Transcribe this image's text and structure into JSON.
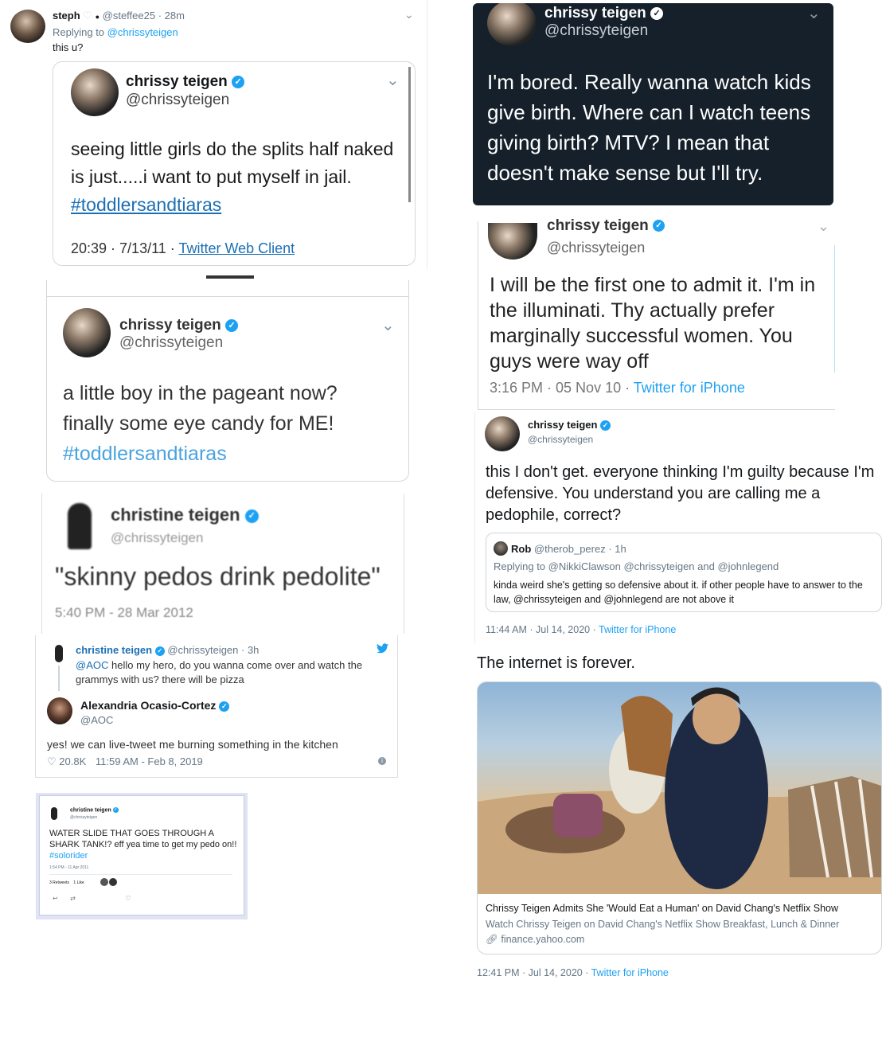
{
  "top_tweet": {
    "name": "steph",
    "handle": "@steffee25",
    "time": "· 28m",
    "replying_prefix": "Replying to",
    "replying_handle": "@chrissyteigen",
    "text": "this u?"
  },
  "s1": {
    "name": "chrissy teigen",
    "handle": "@chrissyteigen",
    "text_main": "seeing little girls do the splits half naked is just.....i want to put myself in jail.",
    "hashtag": "#toddlersandtiaras",
    "meta_time": "20:39 · 7/13/11 ·",
    "meta_source": "Twitter Web Client"
  },
  "s2": {
    "name": "chrissy teigen",
    "handle": "@chrissyteigen",
    "line1": "a little boy in the pageant now?",
    "line2": "finally some eye candy for ME!",
    "hashtag": "#toddlersandtiaras"
  },
  "s3": {
    "name": "christine teigen",
    "handle": "@chrissyteigen",
    "text": "\"skinny pedos drink pedolite\"",
    "meta": "5:40 PM - 28 Mar 2012"
  },
  "s4": {
    "name": "christine teigen",
    "handle": "@chrissyteigen · 3h",
    "mention": "@AOC",
    "text1": "hello my hero, do you wanna come over and watch the",
    "text2": "grammys with us? there will be pizza",
    "reply_name": "Alexandria Ocasio-Cortez",
    "reply_handle": "@AOC",
    "reply_text": "yes! we can live-tweet me burning something in the kitchen",
    "likes": "20.8K",
    "meta": "11:59 AM - Feb 8, 2019"
  },
  "s5": {
    "name": "christine teigen",
    "handle": "@chrissyteigen",
    "text": "WATER SLIDE THAT GOES THROUGH A SHARK TANK!? eff yea time to get my pedo on!!",
    "hashtag": "#solorider",
    "meta": "1:54 PM - 11 Apr 2011",
    "retweets": "3 Retweets",
    "likes": "1 Like"
  },
  "s6": {
    "name": "chrissy teigen",
    "handle": "@chrissyteigen",
    "text": "I'm bored. Really wanna watch kids give birth. Where can I watch teens giving birth? MTV? I mean that doesn't make sense but I'll try."
  },
  "s7": {
    "name": "chrissy teigen",
    "handle": "@chrissyteigen",
    "text": "I will be the first one to admit it. I'm in the illuminati. Thy actually prefer marginally successful women. You guys were way off",
    "meta_time": "3:16 PM · 05 Nov 10 ·",
    "meta_source": "Twitter for iPhone"
  },
  "s8": {
    "name": "chrissy teigen",
    "handle": "@chrissyteigen",
    "text": "this I don't get. everyone thinking I'm guilty because I'm defensive. You understand you are calling me a pedophile, correct?",
    "quote_name": "Rob",
    "quote_handle": "@therob_perez · 1h",
    "quote_replying": "Replying to @NikkiClawson @chrissyteigen and @johnlegend",
    "quote_text": "kinda weird she's getting so defensive about it. if other people have to answer to the law, @chrissyteigen and @johnlegend are not above it",
    "meta_time": "11:44 AM · Jul 14, 2020 ·",
    "meta_source": "Twitter for iPhone"
  },
  "bottom_tweet": {
    "text": "The internet is forever.",
    "card_title": "Chrissy Teigen Admits She 'Would Eat a Human' on David Chang's Netflix Show",
    "card_desc": "Watch Chrissy Teigen on David Chang's Netflix Show Breakfast, Lunch & Dinner",
    "card_domain": "finance.yahoo.com",
    "meta_time": "12:41 PM · Jul 14, 2020 ·",
    "meta_source": "Twitter for iPhone"
  },
  "colors": {
    "twitter_blue": "#1da1f2",
    "link_blue": "#1b6fb5",
    "dark_bg": "#15202b",
    "grey_text": "#657786"
  }
}
